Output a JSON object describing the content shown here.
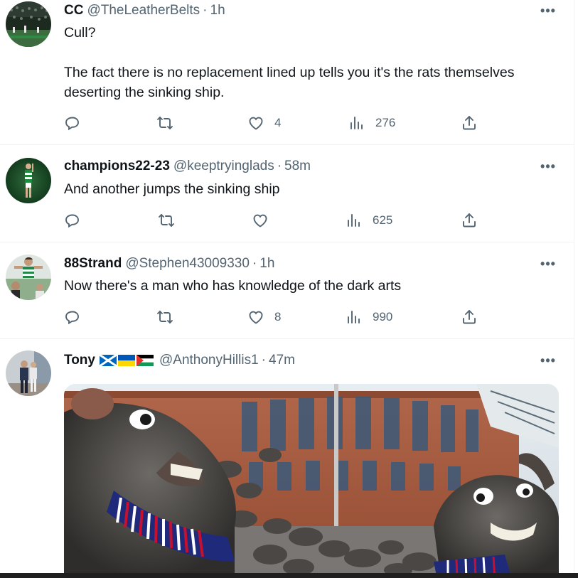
{
  "colors": {
    "text_primary": "#0f1419",
    "text_secondary": "#536471",
    "divider": "#eff3f4"
  },
  "tweets": [
    {
      "name": "CC",
      "handle": "@TheLeatherBelts",
      "separator": "·",
      "time": "1h",
      "text": "Cull?\n\nThe fact there is no replacement lined up tells you it's the rats themselves deserting the sinking ship.",
      "likes": "4",
      "views": "276"
    },
    {
      "name": "champions22-23",
      "handle": "@keeptryinglads",
      "separator": "·",
      "time": "58m",
      "text": "And another jumps the sinking ship",
      "likes": "",
      "views": "625"
    },
    {
      "name": "88Strand",
      "handle": "@Stephen43009330",
      "separator": "·",
      "time": "1h",
      "text": "Now there's a man who has knowledge of the dark arts",
      "likes": "8",
      "views": "990"
    },
    {
      "name": "Tony",
      "handle": "@AnthonyHillis1",
      "separator": "·",
      "time": "47m",
      "flags": [
        "scotland-flag",
        "ukraine-flag",
        "palestine-flag"
      ],
      "media": "image-cartoon-rats-in-scarves-outside-stadium"
    }
  ],
  "more_label": "•••"
}
